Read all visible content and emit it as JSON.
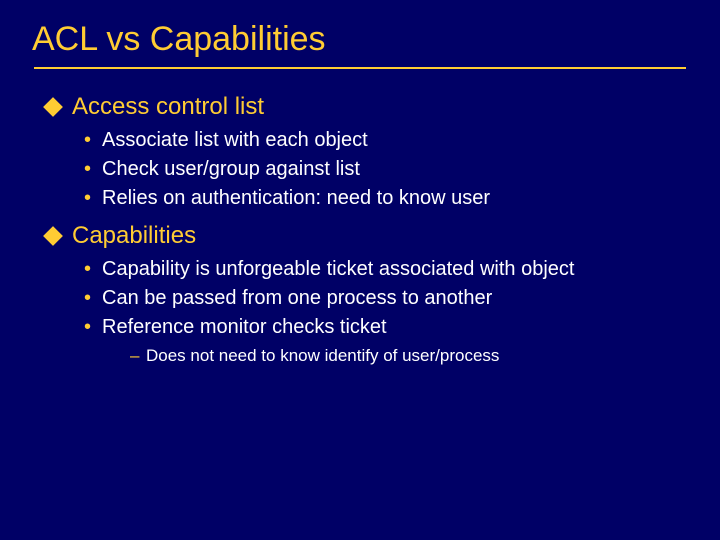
{
  "title": "ACL vs Capabilities",
  "sections": [
    {
      "heading": "Access control list",
      "bullets": [
        {
          "text": "Associate list with each object"
        },
        {
          "text": "Check user/group against list"
        },
        {
          "text": "Relies on authentication: need to know user"
        }
      ]
    },
    {
      "heading": "Capabilities",
      "bullets": [
        {
          "text": "Capability is unforgeable ticket associated with object"
        },
        {
          "text": "Can be passed from one process to another"
        },
        {
          "text": "Reference monitor checks ticket",
          "sub": [
            "Does not need to know identify of user/process"
          ]
        }
      ]
    }
  ]
}
